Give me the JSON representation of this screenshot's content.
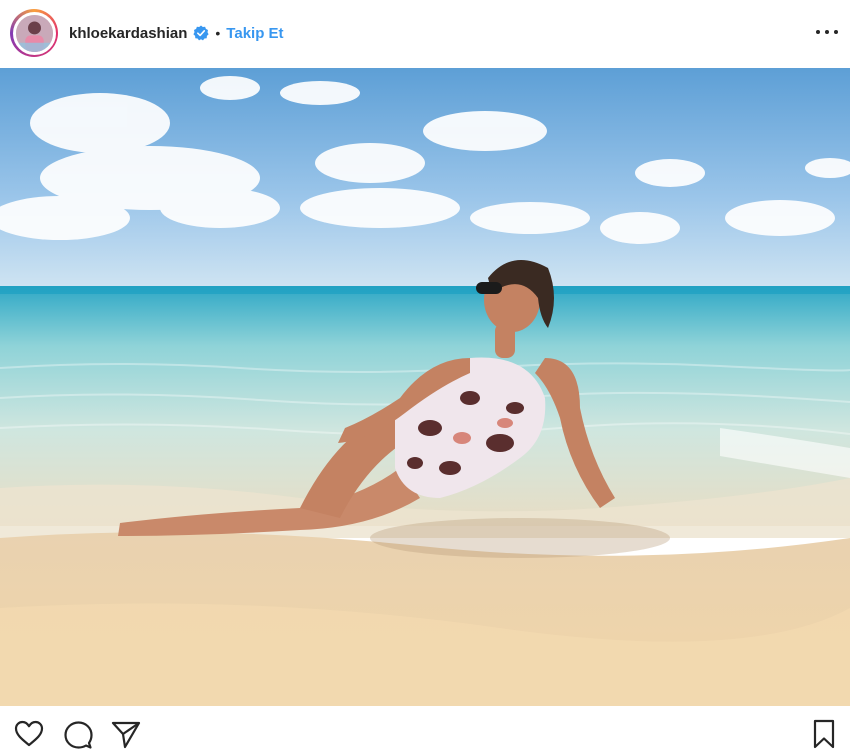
{
  "post": {
    "username": "khloekardashian",
    "verified": true,
    "separator": "•",
    "follow_label": "Takip Et",
    "more_icon": "more-horizontal-icon",
    "image_alt": "Beach photo",
    "actions": {
      "like_icon": "heart-icon",
      "comment_icon": "comment-icon",
      "share_icon": "share-icon",
      "save_icon": "bookmark-icon"
    },
    "colors": {
      "accent": "#3897f0",
      "text": "#262626",
      "sky_top": "#6aa8d8",
      "sea": "#3fc0d0",
      "sand": "#efd2a8"
    }
  }
}
